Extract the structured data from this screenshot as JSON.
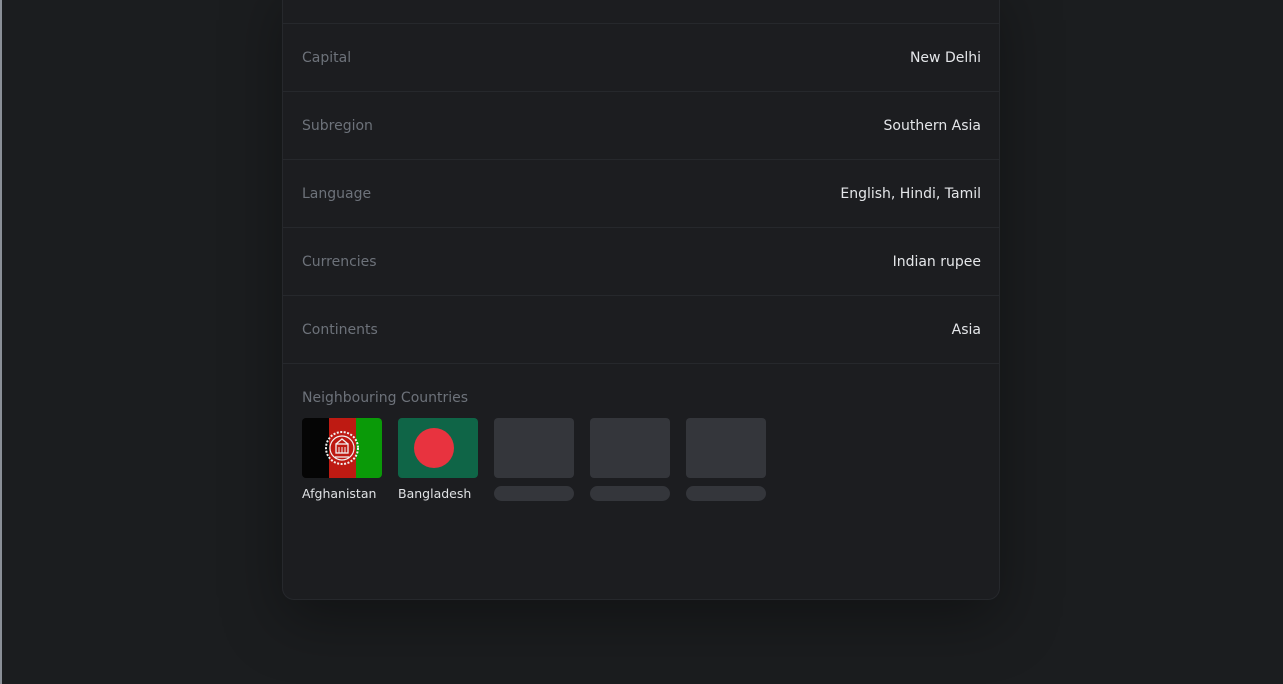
{
  "details": [
    {
      "label": "Capital",
      "value": "New Delhi"
    },
    {
      "label": "Subregion",
      "value": "Southern Asia"
    },
    {
      "label": "Language",
      "value": "English, Hindi, Tamil"
    },
    {
      "label": "Currencies",
      "value": "Indian rupee"
    },
    {
      "label": "Continents",
      "value": "Asia"
    }
  ],
  "neighbours": {
    "title": "Neighbouring Countries",
    "countries": [
      {
        "name": "Afghanistan",
        "flag_icon": "afghanistan-flag-icon"
      },
      {
        "name": "Bangladesh",
        "flag_icon": "bangladesh-flag-icon"
      }
    ],
    "loading_placeholders": 3
  },
  "colors": {
    "page_bg": "#1b1d1f",
    "card_bg": "#1c1d20",
    "label": "#6d727a",
    "value": "#e4e6e9",
    "skeleton": "#34363b",
    "bangladesh_green": "#0f6547",
    "bangladesh_red": "#e8333f"
  }
}
